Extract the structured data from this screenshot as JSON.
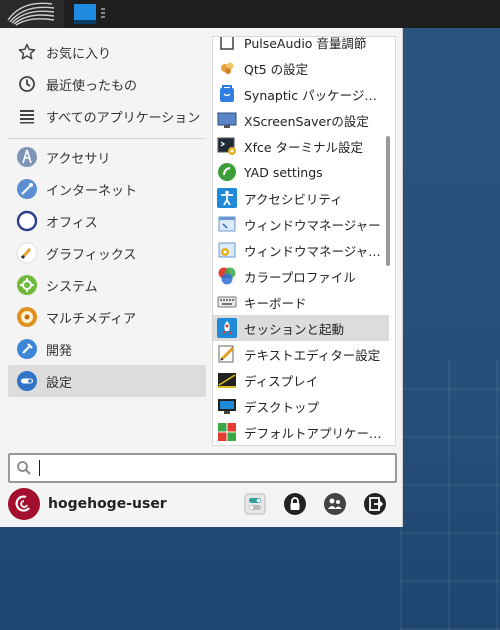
{
  "taskbar": {
    "app_menu_icon": "xfce-swirl-icon",
    "window_button_icon": "window-icon"
  },
  "sidebar": {
    "top_items": [
      {
        "label": "お気に入り",
        "icon": "star-icon"
      },
      {
        "label": "最近使ったもの",
        "icon": "clock-icon"
      },
      {
        "label": "すべてのアプリケーション",
        "icon": "list-icon"
      }
    ],
    "categories": [
      {
        "label": "アクセサリ",
        "icon": "accessories-icon",
        "color": "#6a87b3"
      },
      {
        "label": "インターネット",
        "icon": "internet-icon",
        "color": "#5b8fd1"
      },
      {
        "label": "オフィス",
        "icon": "office-icon",
        "color": "#2a3f8f"
      },
      {
        "label": "グラフィックス",
        "icon": "graphics-icon",
        "color": "#e8a030"
      },
      {
        "label": "システム",
        "icon": "system-icon",
        "color": "#6fba3a"
      },
      {
        "label": "マルチメディア",
        "icon": "multimedia-icon",
        "color": "#e0901c"
      },
      {
        "label": "開発",
        "icon": "development-icon",
        "color": "#3d87d8"
      },
      {
        "label": "設定",
        "icon": "settings-icon",
        "color": "#2f74c6"
      }
    ],
    "selected": "設定"
  },
  "apps": [
    {
      "label": "PulseAudio 音量調節",
      "icon": "pulseaudio-icon"
    },
    {
      "label": "Qt5 の設定",
      "icon": "qt-icon"
    },
    {
      "label": "Synaptic パッケージ…",
      "icon": "synaptic-icon"
    },
    {
      "label": "XScreenSaverの設定",
      "icon": "xscreensaver-icon"
    },
    {
      "label": "Xfce ターミナル設定",
      "icon": "terminal-settings-icon"
    },
    {
      "label": "YAD settings",
      "icon": "yad-icon"
    },
    {
      "label": "アクセシビリティ",
      "icon": "accessibility-icon"
    },
    {
      "label": "ウィンドウマネージャー",
      "icon": "window-manager-icon"
    },
    {
      "label": "ウィンドウマネージャ…",
      "icon": "window-manager-tweaks-icon"
    },
    {
      "label": "カラープロファイル",
      "icon": "color-profile-icon"
    },
    {
      "label": "キーボード",
      "icon": "keyboard-icon"
    },
    {
      "label": "セッションと起動",
      "icon": "session-startup-icon"
    },
    {
      "label": "テキストエディター設定",
      "icon": "text-editor-settings-icon"
    },
    {
      "label": "ディスプレイ",
      "icon": "display-icon"
    },
    {
      "label": "デスクトップ",
      "icon": "desktop-icon"
    },
    {
      "label": "デフォルトアプリケー…",
      "icon": "default-apps-icon"
    }
  ],
  "selected_app": "セッションと起動",
  "search": {
    "value": "",
    "placeholder": ""
  },
  "user": {
    "name": "hogehoge-user",
    "avatar_icon": "debian-icon"
  },
  "actions": [
    {
      "name": "settings-manager-icon"
    },
    {
      "name": "lock-screen-icon"
    },
    {
      "name": "switch-user-icon"
    },
    {
      "name": "logout-icon"
    }
  ],
  "colors": {
    "desktop_bg": "#26507a",
    "menu_bg": "#f4f4f4",
    "selection": "#dcdcdc",
    "debian_red": "#a30f2d"
  }
}
